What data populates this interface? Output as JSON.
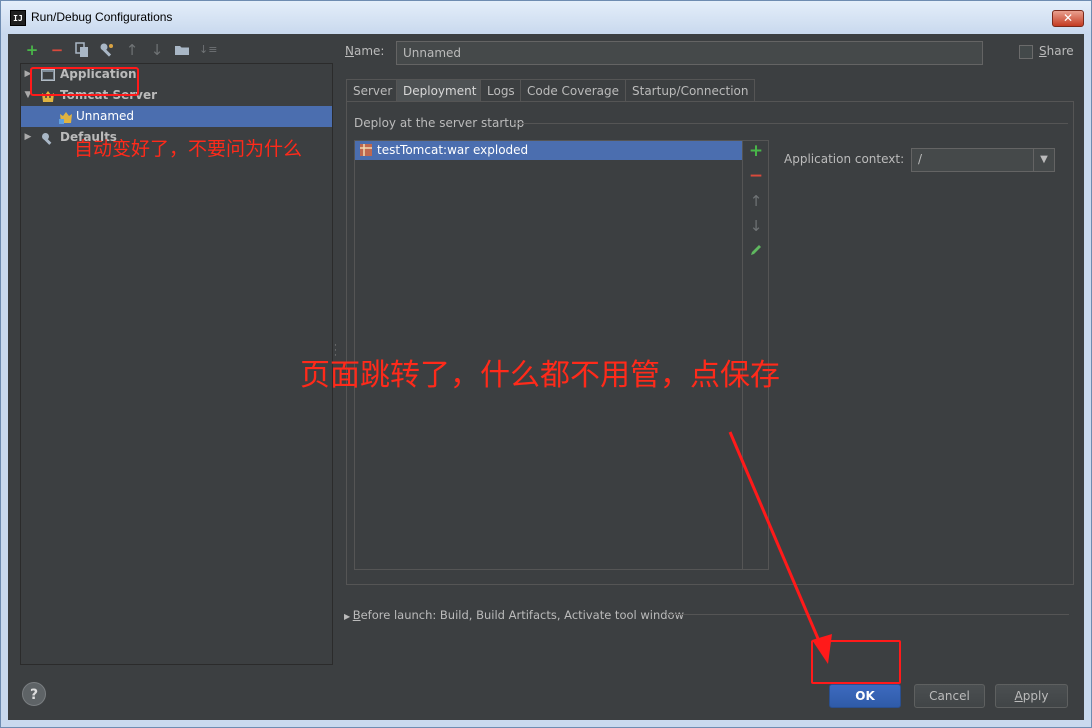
{
  "window": {
    "title": "Run/Debug Configurations",
    "app_icon": "IJ",
    "close": "✕"
  },
  "toolbar": {
    "icons": [
      "add-icon",
      "remove-icon",
      "copy-icon",
      "wrench-icon",
      "move-up-icon",
      "move-down-icon",
      "folder-icon",
      "sort-icon"
    ]
  },
  "tree": {
    "items": [
      {
        "label": "Application",
        "expanded": false,
        "icon": "application-icon"
      },
      {
        "label": "Tomcat Server",
        "expanded": true,
        "icon": "tomcat-icon"
      },
      {
        "label": "Unnamed",
        "selected": true,
        "icon": "tomcat-config-icon"
      },
      {
        "label": "Defaults",
        "expanded": false,
        "icon": "wrench-icon"
      }
    ]
  },
  "annotations": {
    "left_note": "自动变好了，不要问为什么",
    "center_note": "页面跳转了，什么都不用管，点保存",
    "color": "#ff2a1a"
  },
  "name_field": {
    "label": "Name:",
    "label_mnemonic": "N",
    "label_rest": "ame:",
    "value": "Unnamed"
  },
  "share": {
    "label": "Share",
    "label_mnemonic": "S",
    "label_rest": "hare",
    "checked": false
  },
  "tabs": [
    {
      "label": "Server",
      "active": false
    },
    {
      "label": "Deployment",
      "active": true
    },
    {
      "label": "Logs",
      "active": false
    },
    {
      "label": "Code Coverage",
      "active": false
    },
    {
      "label": "Startup/Connection",
      "active": false
    }
  ],
  "deployment": {
    "header": "Deploy at the server startup",
    "items": [
      {
        "label": "testTomcat:war exploded",
        "selected": true
      }
    ],
    "list_tools": [
      "add-icon",
      "remove-icon",
      "move-up-icon",
      "move-down-icon",
      "edit-icon"
    ],
    "context_label": "Application context:",
    "context_value": "/"
  },
  "before_launch": {
    "mnemonic": "B",
    "rest": "efore launch: Build, Build Artifacts, Activate tool window"
  },
  "buttons": {
    "help": "?",
    "ok": "OK",
    "cancel": "Cancel",
    "apply_mnemonic": "A",
    "apply_rest": "pply"
  },
  "colors": {
    "selection": "#4b6eaf",
    "background": "#3c3f41",
    "add_green": "#49b749",
    "remove_red": "#d94a3c"
  }
}
